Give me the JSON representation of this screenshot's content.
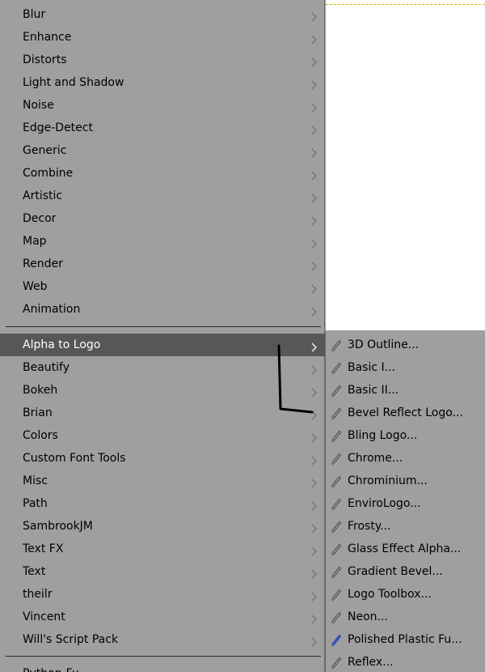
{
  "menu": {
    "items_top": [
      {
        "label": "Blur"
      },
      {
        "label": "Enhance"
      },
      {
        "label": "Distorts"
      },
      {
        "label": "Light and Shadow"
      },
      {
        "label": "Noise"
      },
      {
        "label": "Edge-Detect"
      },
      {
        "label": "Generic"
      },
      {
        "label": "Combine"
      },
      {
        "label": "Artistic"
      },
      {
        "label": "Decor"
      },
      {
        "label": "Map"
      },
      {
        "label": "Render"
      },
      {
        "label": "Web"
      },
      {
        "label": "Animation"
      }
    ],
    "items_scripts": [
      {
        "label": "Alpha to Logo",
        "highlighted": true
      },
      {
        "label": "Beautify"
      },
      {
        "label": "Bokeh"
      },
      {
        "label": "Brian"
      },
      {
        "label": "Colors"
      },
      {
        "label": "Custom Font Tools"
      },
      {
        "label": "Misc"
      },
      {
        "label": "Path"
      },
      {
        "label": "SambrookJM"
      },
      {
        "label": "Text FX"
      },
      {
        "label": "Text"
      },
      {
        "label": "theilr"
      },
      {
        "label": "Vincent"
      },
      {
        "label": "Will's Script Pack"
      }
    ],
    "partial_bottom_item": {
      "label": "Python-Fu"
    }
  },
  "submenu": {
    "title_parent": "Alpha to Logo",
    "items": [
      {
        "label": "3D Outline...",
        "icon": "script-fu-icon"
      },
      {
        "label": "Basic I...",
        "icon": "script-fu-icon"
      },
      {
        "label": "Basic II...",
        "icon": "script-fu-icon"
      },
      {
        "label": "Bevel Reflect Logo...",
        "icon": "script-fu-icon"
      },
      {
        "label": "Bling Logo...",
        "icon": "script-fu-icon"
      },
      {
        "label": "Chrome...",
        "icon": "script-fu-icon"
      },
      {
        "label": "Chrominium...",
        "icon": "script-fu-icon"
      },
      {
        "label": "EnviroLogo...",
        "icon": "script-fu-icon"
      },
      {
        "label": "Frosty...",
        "icon": "script-fu-icon"
      },
      {
        "label": "Glass Effect Alpha...",
        "icon": "script-fu-icon"
      },
      {
        "label": "Gradient Bevel...",
        "icon": "script-fu-icon"
      },
      {
        "label": "Logo Toolbox...",
        "icon": "script-fu-icon"
      },
      {
        "label": "Neon...",
        "icon": "script-fu-icon"
      },
      {
        "label": "Polished Plastic Fu...",
        "icon": "python-fu-icon"
      },
      {
        "label": "Reflex...",
        "icon": "script-fu-icon"
      }
    ]
  },
  "colors": {
    "menu_bg": "#9f9f9f",
    "highlight_bg": "#575757",
    "highlight_text": "#ffffff",
    "text": "#000000",
    "canvas": "#ffffff",
    "annotation_stroke": "#000000"
  }
}
